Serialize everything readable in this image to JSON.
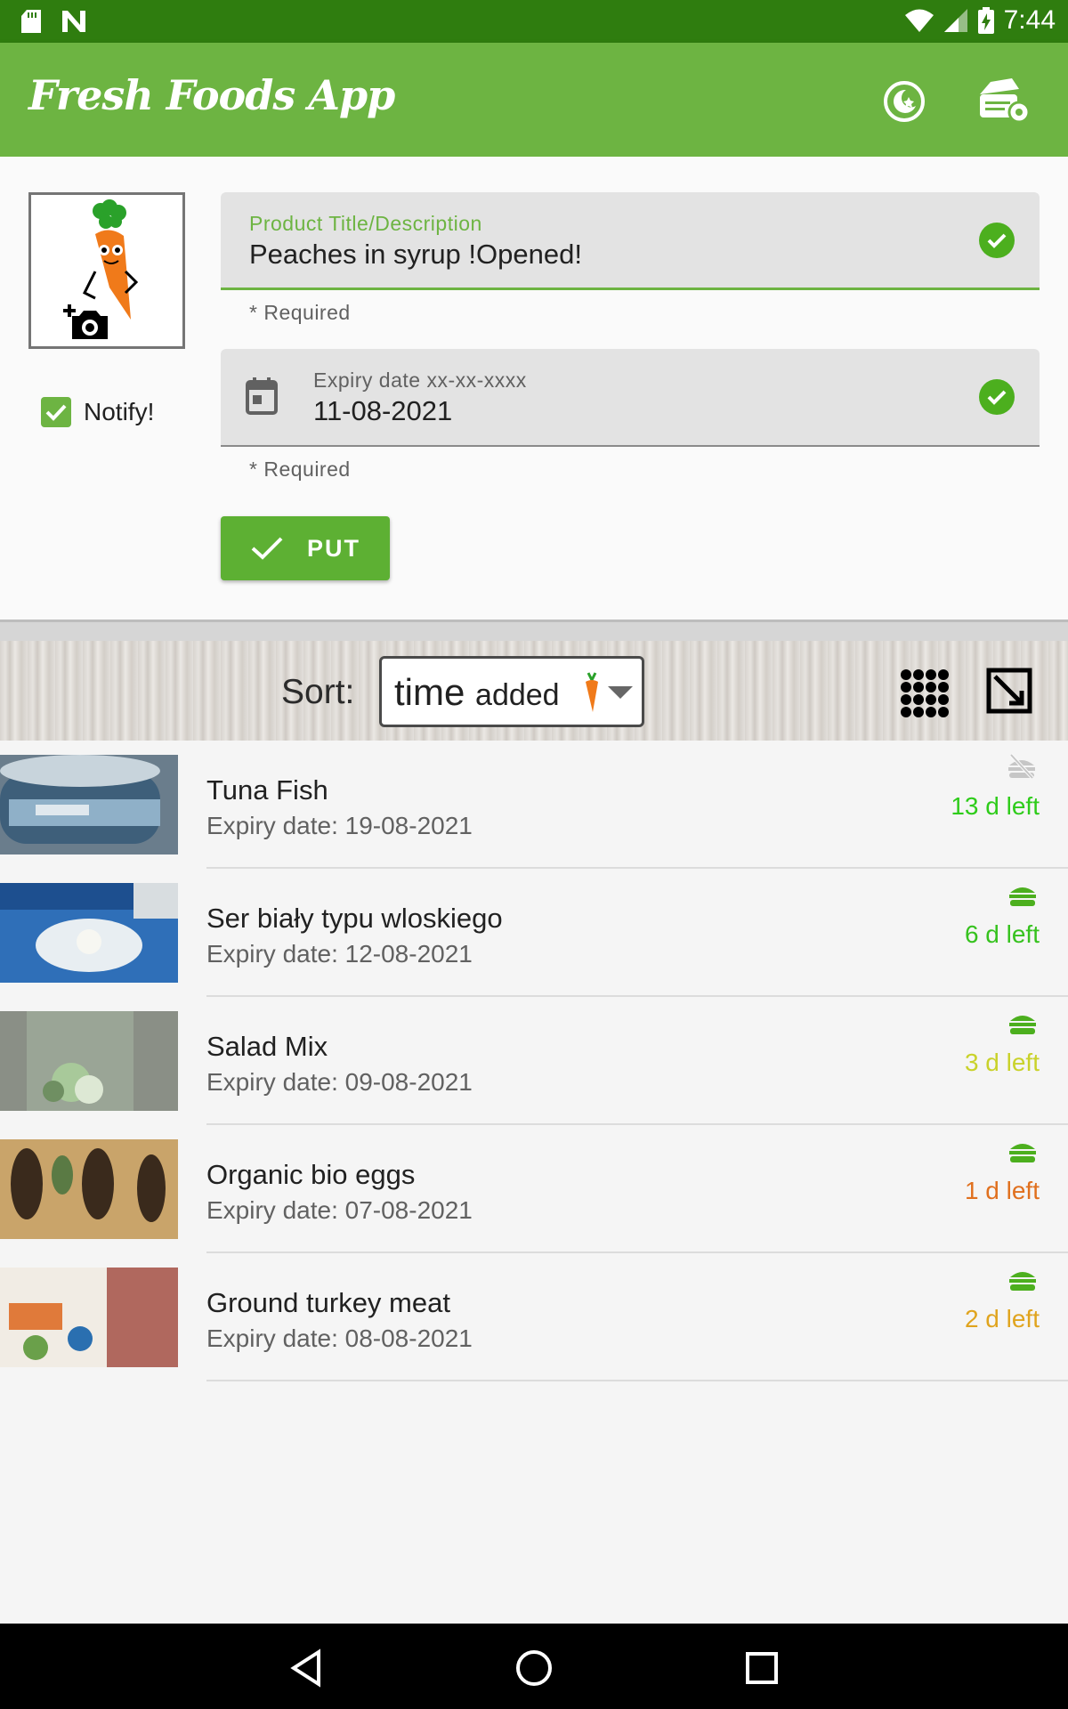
{
  "status_bar": {
    "time": "7:44"
  },
  "app_bar": {
    "title": "Fresh Foods App"
  },
  "form": {
    "title_field": {
      "label": "Product Title/Description",
      "value": "Peaches in syrup !Opened!",
      "helper": "* Required"
    },
    "date_field": {
      "label": "Expiry date xx-xx-xxxx",
      "value": "11-08-2021",
      "helper": "* Required"
    },
    "notify_label": "Notify!",
    "notify_checked": true,
    "put_label": "PUT"
  },
  "sort": {
    "label": "Sort:",
    "selected_main": "time",
    "selected_sub": "added"
  },
  "items": [
    {
      "name": "Tuna Fish",
      "expiry": "Expiry date: 19-08-2021",
      "left": "13 d left",
      "color": "#2ecc1a",
      "status_icon": "no-food-icon"
    },
    {
      "name": "Ser biały typu wloskiego",
      "expiry": "Expiry date: 12-08-2021",
      "left": "6 d left",
      "color": "#36c21e",
      "status_icon": "food-icon"
    },
    {
      "name": "Salad Mix",
      "expiry": "Expiry date: 09-08-2021",
      "left": "3 d left",
      "color": "#c9d22a",
      "status_icon": "food-icon"
    },
    {
      "name": "Organic bio eggs",
      "expiry": "Expiry date: 07-08-2021",
      "left": "1 d left",
      "color": "#e0701e",
      "status_icon": "food-icon"
    },
    {
      "name": "Ground turkey meat",
      "expiry": "Expiry date: 08-08-2021",
      "left": "2 d left",
      "color": "#e0a41e",
      "status_icon": "food-icon"
    }
  ],
  "colors": {
    "primary": "#6db442",
    "status_bar": "#2f7d0f",
    "accent_green": "#4caf1e"
  }
}
